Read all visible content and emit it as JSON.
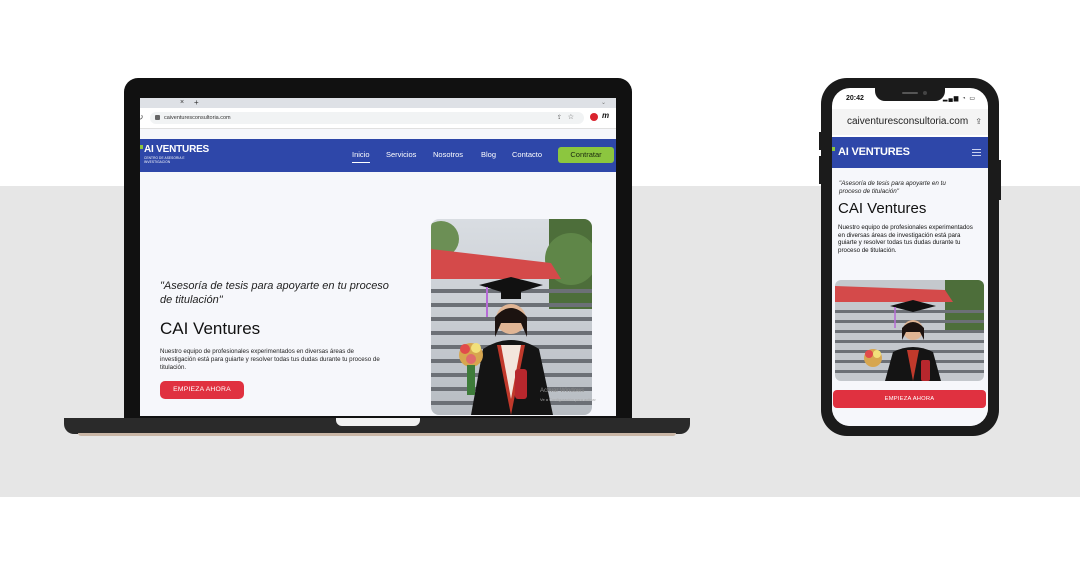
{
  "laptop": {
    "browser": {
      "tab_close": "×",
      "tab_new": "+",
      "tab_menu": "⌄",
      "url": "caiventuresconsultoria.com",
      "reload": "↻",
      "share": "⇪",
      "star": "☆",
      "ext_label": "m"
    },
    "site": {
      "logo_main": "AI VENTURES",
      "logo_sub_1": "CENTRO DE ASESORIA E",
      "logo_sub_2": "INVESTIGACION",
      "nav": [
        {
          "label": "Inicio"
        },
        {
          "label": "Servicios"
        },
        {
          "label": "Nosotros"
        },
        {
          "label": "Blog"
        },
        {
          "label": "Contacto"
        }
      ],
      "cta": "Contratar",
      "quote": "\"Asesoría de tesis para apoyarte en tu proceso de titulación\"",
      "title": "CAI Ventures",
      "description": "Nuestro equipo de profesionales experimentados en diversas áreas de investigación está para guiarte y resolver todas tus dudas durante tu proceso de titulación.",
      "button": "EMPIEZA AHORA",
      "watermark": "Activar Windows",
      "watermark_sub": "Ve a Configuración para activar"
    }
  },
  "phone": {
    "status": {
      "time": "20:42",
      "icons": "▂▄▆ ◔ ▭"
    },
    "url": "caiventuresconsultoria.com",
    "share": "⇪",
    "site": {
      "logo_main": "AI VENTURES",
      "quote": "\"Asesoría de tesis para apoyarte en tu proceso de titulación\"",
      "title": "CAI Ventures",
      "description": "Nuestro equipo de profesionales experimentados en diversas áreas de investigación está para guiarte y resolver todas tus dudas durante tu proceso de titulación.",
      "button": "EMPIEZA AHORA"
    }
  },
  "colors": {
    "nav_blue": "#2e47a9",
    "cta_green": "#8cc63f",
    "button_red": "#e03140"
  }
}
